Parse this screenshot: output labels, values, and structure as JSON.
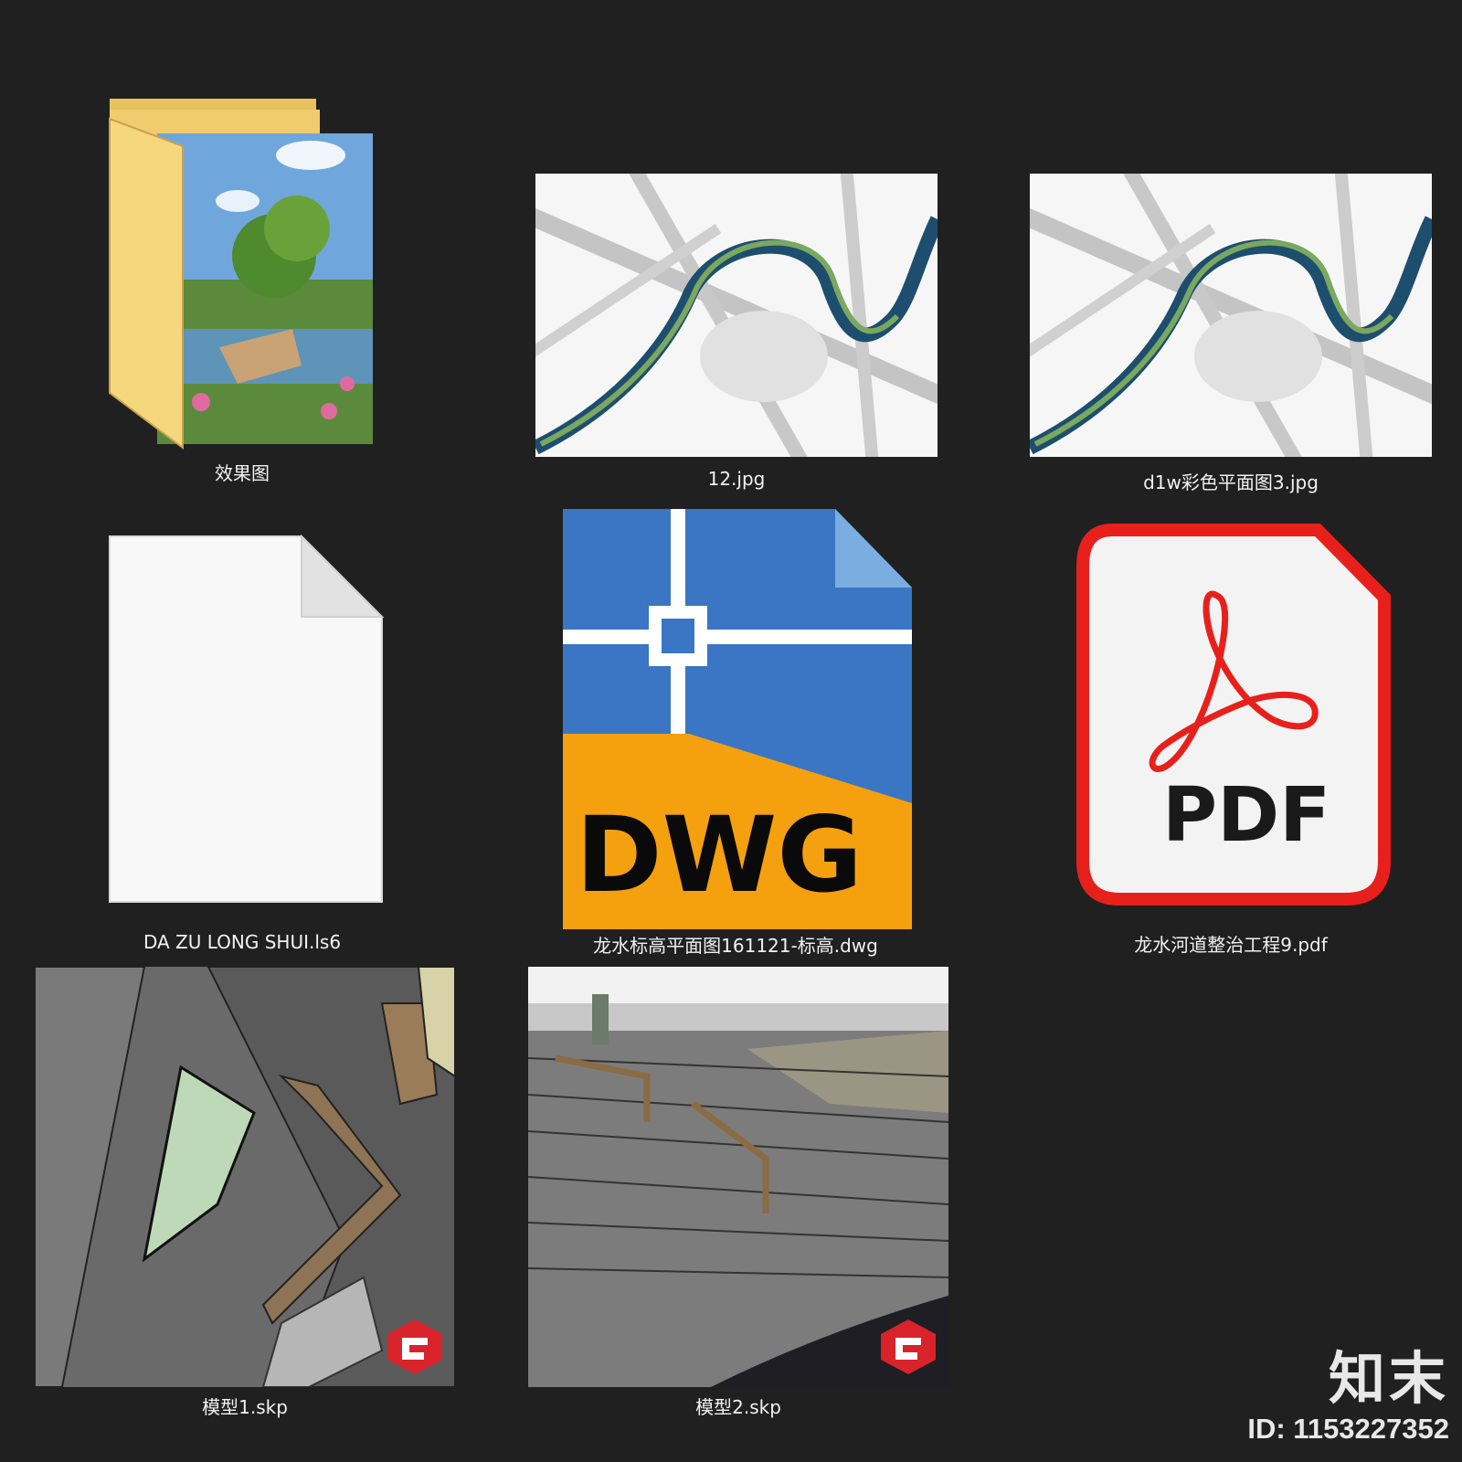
{
  "files": [
    {
      "name": "效果图",
      "icon": "folder-icon"
    },
    {
      "name": "12.jpg",
      "icon": "image-thumbnail"
    },
    {
      "name": "d1w彩色平面图3.jpg",
      "icon": "image-thumbnail"
    },
    {
      "name": "DA ZU LONG  SHUI.ls6",
      "icon": "blank-file-icon"
    },
    {
      "name": "龙水标高平面图161121-标高.dwg",
      "icon": "dwg-file-icon",
      "badge": "DWG"
    },
    {
      "name": "龙水河道整治工程9.pdf",
      "icon": "pdf-file-icon",
      "badge": "PDF"
    },
    {
      "name": "模型1.skp",
      "icon": "sketchup-thumbnail"
    },
    {
      "name": "模型2.skp",
      "icon": "sketchup-thumbnail"
    }
  ],
  "watermark": {
    "logo": "知末",
    "id": "ID: 1153227352"
  },
  "colors": {
    "background": "#202020",
    "dwg_blue": "#3a76c4",
    "dwg_orange": "#f5a00f",
    "pdf_red": "#e8201c",
    "river": "#1e4e6e"
  }
}
